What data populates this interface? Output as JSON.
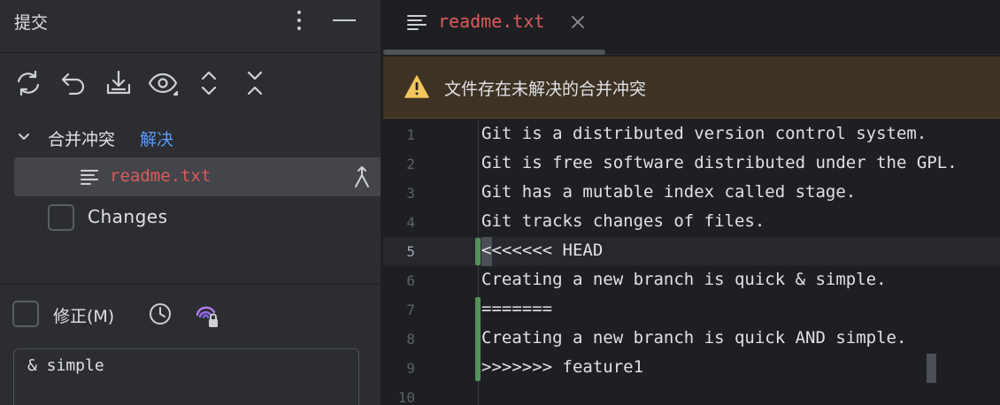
{
  "commit_panel": {
    "title": "提交",
    "more_icon": "more-vertical-icon",
    "minimize_icon": "minimize-icon",
    "toolbar": [
      "refresh-icon",
      "rollback-icon",
      "update-download-icon",
      "preview-eye-icon",
      "expand-all-icon",
      "collapse-all-icon"
    ],
    "merge_group": {
      "label": "合并冲突",
      "resolve_link": "解决",
      "file": "readme.txt"
    },
    "changes_group": {
      "label": "Changes",
      "checked": false
    },
    "amend": {
      "label": "修正(M)",
      "checked": false
    },
    "message": "& simple"
  },
  "editor": {
    "tab": {
      "label": "readme.txt"
    },
    "banner": {
      "text": "文件存在未解决的合并冲突"
    },
    "lines": [
      "Git is a distributed version control system.",
      "Git is free software distributed under the GPL.",
      "Git has a mutable index called stage.",
      "Git tracks changes of files.",
      "<<<<<<< HEAD",
      "Creating a new branch is quick & simple.",
      "=======",
      "Creating a new branch is quick AND simple.",
      ">>>>>>> feature1",
      ""
    ],
    "line_numbers": [
      "1",
      "2",
      "3",
      "4",
      "5",
      "6",
      "7",
      "8",
      "9",
      "10"
    ],
    "current_line": 5
  },
  "colors": {
    "conflict_file": "#db5c5c",
    "link": "#589df6",
    "banner_bg": "#3d3223",
    "gutter_change": "#549159",
    "warning": "#f2c55c"
  }
}
